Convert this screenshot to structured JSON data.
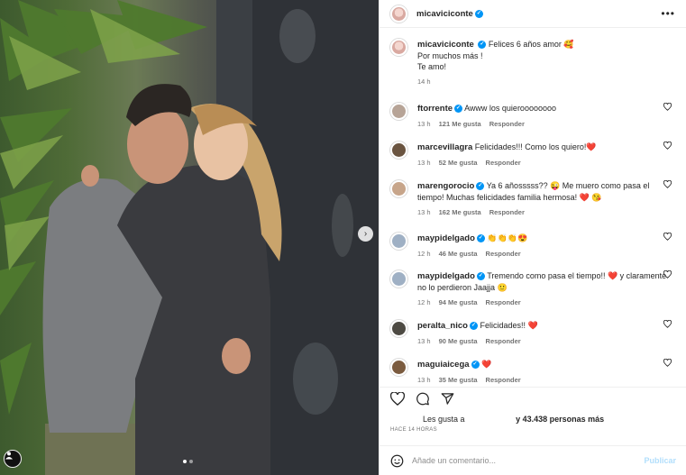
{
  "post": {
    "author": "micaviciconte",
    "caption_lines": [
      "Felices 6 años amor 🥰",
      "Por muchos más !",
      "Te amo!"
    ],
    "caption_time": "14 h",
    "more_icon": "more-horizontal-icon"
  },
  "carousel": {
    "next_icon": "chevron-right-icon",
    "slide_count": 2,
    "active_slide": 1
  },
  "comments": [
    {
      "user": "ftorrente",
      "verified": true,
      "text": "Awww los quieroooooooo",
      "time": "13 h",
      "likes": "121 Me gusta",
      "reply": "Responder",
      "avatar_color": "#b7a497"
    },
    {
      "user": "marcevillagra",
      "verified": false,
      "text": "Felicidades!!! Como los quiero!❤️",
      "time": "13 h",
      "likes": "52 Me gusta",
      "reply": "Responder",
      "avatar_color": "#6a5440"
    },
    {
      "user": "marengorocio",
      "verified": true,
      "text": "Ya 6 añosssss?? 😜 Me muero como pasa el tiempo! Muchas felicidades familia hermosa! ❤️ 😘",
      "time": "13 h",
      "likes": "162 Me gusta",
      "reply": "Responder",
      "avatar_color": "#c7a58a"
    },
    {
      "user": "maypidelgado",
      "verified": true,
      "text": "👏👏👏😍",
      "time": "12 h",
      "likes": "46 Me gusta",
      "reply": "Responder",
      "avatar_color": "#9fb0c4"
    },
    {
      "user": "maypidelgado",
      "verified": true,
      "text": "Tremendo como pasa el tiempo!! ❤️ y claramente no lo perdieron Jaajja 🙂",
      "time": "12 h",
      "likes": "94 Me gusta",
      "reply": "Responder",
      "avatar_color": "#9fb0c4"
    },
    {
      "user": "peralta_nico",
      "verified": true,
      "text": "Felicidades!! ❤️",
      "time": "13 h",
      "likes": "90 Me gusta",
      "reply": "Responder",
      "avatar_color": "#4d4a43"
    },
    {
      "user": "maguiaicega",
      "verified": true,
      "text": "❤️",
      "time": "13 h",
      "likes": "35 Me gusta",
      "reply": "Responder",
      "avatar_color": "#7b5b3f"
    }
  ],
  "actions": {
    "like_icon": "heart-icon",
    "comment_icon": "comment-icon",
    "share_icon": "send-icon"
  },
  "likes_line": {
    "prefix": "Les gusta a",
    "suffix": "y 43.438 personas más"
  },
  "post_time": "HACE 14 HORAS",
  "composer": {
    "emoji_icon": "smiley-icon",
    "placeholder": "Añade un comentario...",
    "publish_label": "Publicar"
  }
}
